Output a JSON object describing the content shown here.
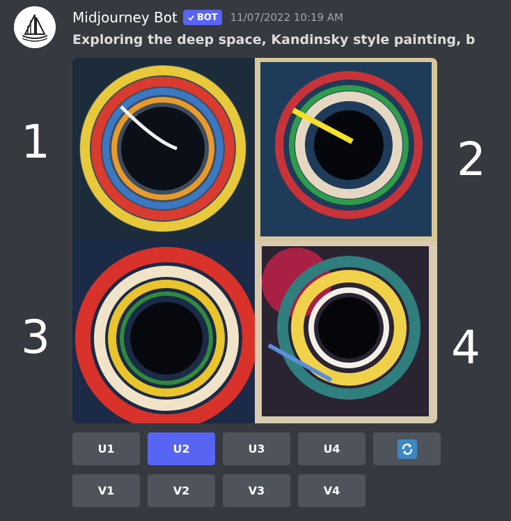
{
  "message": {
    "author": "Midjourney Bot",
    "bot_badge": "BOT",
    "timestamp": "11/07/2022 10:19 AM",
    "prompt": "Exploring the deep space, Kandinsky style painting, b"
  },
  "image_labels": [
    "1",
    "2",
    "3",
    "4"
  ],
  "upscale_buttons": [
    "U1",
    "U2",
    "U3",
    "U4"
  ],
  "variation_buttons": [
    "V1",
    "V2",
    "V3",
    "V4"
  ],
  "active_button": "U2",
  "icons": {
    "avatar": "sailboat-icon",
    "refresh": "refresh-icon",
    "verified": "checkmark-icon"
  },
  "colors": {
    "background": "#36393f",
    "button": "#4f545c",
    "accent": "#5865f2"
  }
}
